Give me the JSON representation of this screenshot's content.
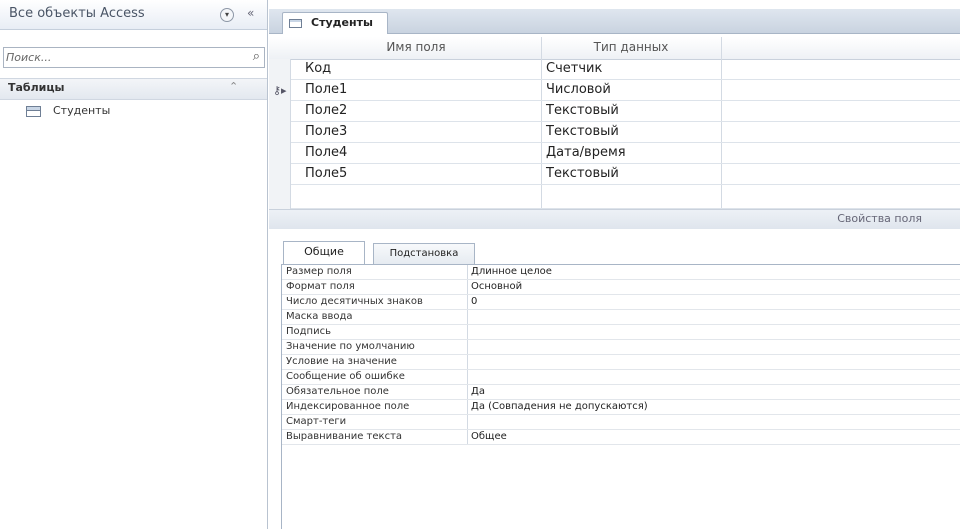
{
  "nav": {
    "title": "Все объекты Access",
    "menu_icon": "chevron-down-circle-icon",
    "collapse_icon": "double-chevron-left-icon",
    "search_placeholder": "Поиск...",
    "search_icon": "search-icon",
    "group_label": "Таблицы",
    "group_chevron": "chevron-up-icon",
    "items": [
      {
        "label": "Студенты",
        "icon": "table-icon"
      }
    ]
  },
  "document": {
    "tab_label": "Студенты",
    "tab_icon": "table-icon",
    "columns": {
      "field_name": "Имя поля",
      "data_type": "Тип данных"
    },
    "fields": [
      {
        "name": "Код",
        "type": "Счетчик"
      },
      {
        "name": "Поле1",
        "type": "Числовой"
      },
      {
        "name": "Поле2",
        "type": "Текстовый"
      },
      {
        "name": "Поле3",
        "type": "Текстовый"
      },
      {
        "name": "Поле4",
        "type": "Дата/время"
      },
      {
        "name": "Поле5",
        "type": "Текстовый"
      }
    ],
    "current_row_icon": "key-pointer-icon",
    "properties_caption": "Свойства поля"
  },
  "properties": {
    "tabs": [
      "Общие",
      "Подстановка"
    ],
    "active_tab": "Общие",
    "rows": [
      {
        "name": "Размер поля",
        "value": "Длинное целое"
      },
      {
        "name": "Формат поля",
        "value": "Основной"
      },
      {
        "name": "Число десятичных знаков",
        "value": "0"
      },
      {
        "name": "Маска ввода",
        "value": ""
      },
      {
        "name": "Подпись",
        "value": ""
      },
      {
        "name": "Значение по умолчанию",
        "value": ""
      },
      {
        "name": "Условие на значение",
        "value": ""
      },
      {
        "name": "Сообщение об ошибке",
        "value": ""
      },
      {
        "name": "Обязательное поле",
        "value": "Да"
      },
      {
        "name": "Индексированное поле",
        "value": "Да (Совпадения не допускаются)"
      },
      {
        "name": "Смарт-теги",
        "value": ""
      },
      {
        "name": "Выравнивание текста",
        "value": "Общее"
      }
    ]
  }
}
